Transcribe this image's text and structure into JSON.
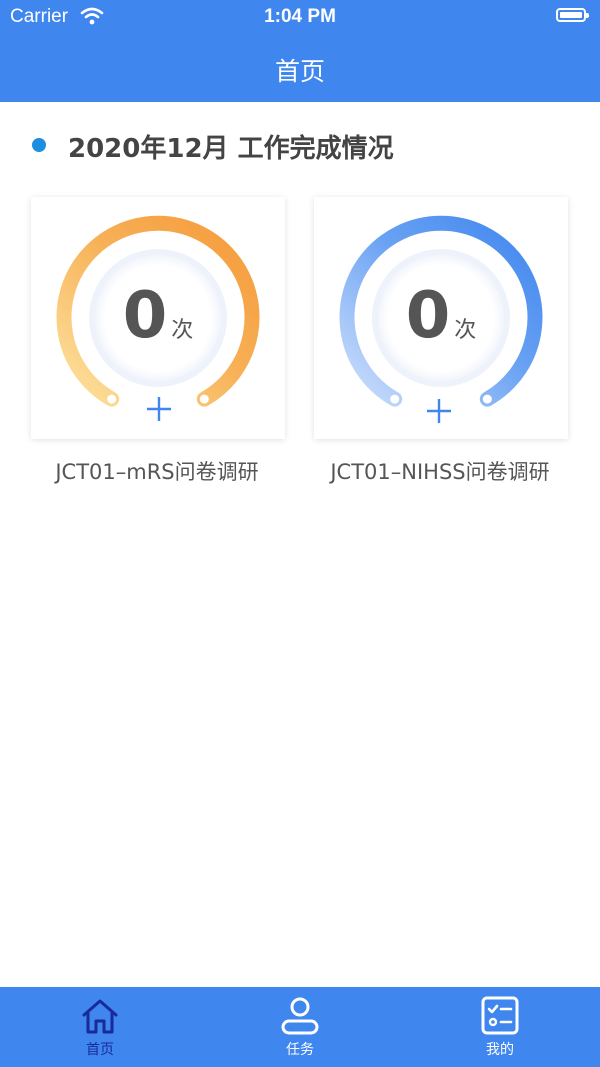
{
  "status_bar": {
    "carrier": "Carrier",
    "time": "1:04 PM"
  },
  "nav": {
    "title": "首页"
  },
  "section": {
    "title": "2020年12月 工作完成情况",
    "dot_color": "#1e8fe0"
  },
  "cards": [
    {
      "count": "0",
      "unit": "次",
      "label": "JCT01–mRS问卷调研",
      "gauge_color_start": "#fbd98c",
      "gauge_color_end": "#f59a3a",
      "plus_icon": "plus-icon"
    },
    {
      "count": "0",
      "unit": "次",
      "label": "JCT01–NIHSS问卷调研",
      "gauge_color_start": "#c2d8fb",
      "gauge_color_end": "#3f86ef",
      "plus_icon": "plus-icon"
    }
  ],
  "tabbar": {
    "items": [
      {
        "label": "首页",
        "icon": "home-icon",
        "active": true
      },
      {
        "label": "任务",
        "icon": "user-icon",
        "active": false
      },
      {
        "label": "我的",
        "icon": "checklist-icon",
        "active": false
      }
    ]
  },
  "colors": {
    "primary": "#3f86ef",
    "active_tab": "#1a2a9a"
  }
}
